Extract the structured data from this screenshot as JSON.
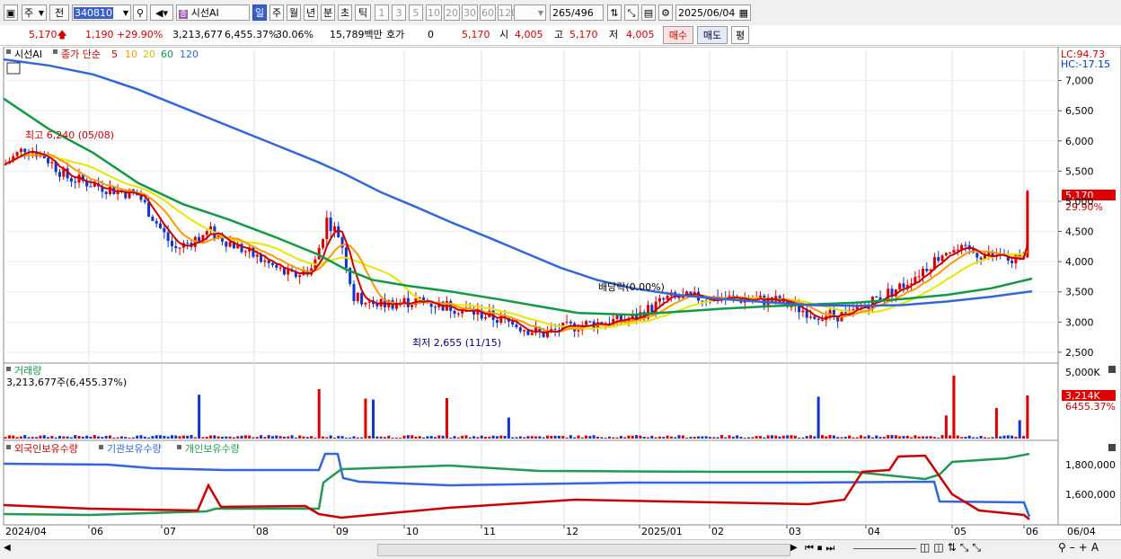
{
  "toolbar": {
    "market_select": "주",
    "type_select": "전",
    "code_value": "340810",
    "stock_name": "시선AI",
    "periods": [
      "일",
      "주",
      "월",
      "년",
      "분",
      "초",
      "틱"
    ],
    "period_selected": "일",
    "minutes": [
      "1",
      "3",
      "5",
      "10",
      "20",
      "30",
      "60",
      "120"
    ],
    "count_value": "265",
    "count_total": "/496",
    "date_value": "2025/06/04"
  },
  "quote": {
    "price": "5,170",
    "change": "1,190",
    "change_pct": "+29.90%",
    "volume": "3,213,677",
    "volume_pct": "6,455.37%",
    "turnover": "30.06%",
    "amount": "15,789백만",
    "hoga_label": "호가",
    "hoga_value": "0",
    "hoga_price": "5,170",
    "open_label": "시",
    "open_value": "4,005",
    "high_label": "고",
    "high_value": "5,170",
    "low_label": "저",
    "low_value": "4,005",
    "buy_label": "매수",
    "sell_label": "매도",
    "eval_label": "평"
  },
  "price_panel": {
    "stock_label": "시선AI",
    "ma_label": "종가 단순",
    "ma_periods": [
      "5",
      "10",
      "20",
      "60",
      "120"
    ],
    "ma_colors": [
      "#cc0000",
      "#ff9900",
      "#e6e600",
      "#119944",
      "#3366dd"
    ],
    "lc_label": "LC:94.73",
    "hc_label": "HC:-17.15",
    "high_annotation": "최고 6,240 (05/08)",
    "low_annotation": "최저 2,655 (11/15)",
    "dividend_annotation": "배당락(0.00%)",
    "current_price": "5,170",
    "current_pct": "29.90%",
    "y_ticks": [
      "7,000",
      "6,500",
      "6,000",
      "5,500",
      "5,000",
      "4,500",
      "4,000",
      "3,500",
      "3,000",
      "2,500"
    ]
  },
  "volume_panel": {
    "title": "거래량",
    "value_label": "3,213,677주(6,455.37%)",
    "y_tick": "5,000K",
    "current": "3,214K",
    "current_pct": "6455.37%"
  },
  "holding_panel": {
    "legend": [
      "외국인보유수량",
      "기관보유수량",
      "개인보유수량"
    ],
    "legend_colors": [
      "#cc0000",
      "#3366dd",
      "#229955"
    ],
    "y_ticks": [
      "1,800,000",
      "1,600,000"
    ]
  },
  "x_axis": [
    "2024/04",
    "06",
    "07",
    "08",
    "09",
    "10",
    "11",
    "12",
    "2025/01",
    "02",
    "03",
    "04",
    "05",
    "06",
    "06/04"
  ],
  "chart_data": {
    "type": "candlestick",
    "price_y_range": [
      2350,
      7500
    ],
    "moving_averages": {
      "ma60_points": [
        [
          0,
          6700
        ],
        [
          20,
          6500
        ],
        [
          50,
          6200
        ],
        [
          100,
          5800
        ],
        [
          150,
          5300
        ],
        [
          200,
          4950
        ],
        [
          250,
          4700
        ],
        [
          300,
          4420
        ],
        [
          350,
          4120
        ],
        [
          380,
          3880
        ],
        [
          410,
          3700
        ],
        [
          450,
          3600
        ],
        [
          500,
          3500
        ],
        [
          550,
          3380
        ],
        [
          600,
          3250
        ],
        [
          640,
          3150
        ],
        [
          700,
          3120
        ],
        [
          750,
          3170
        ],
        [
          800,
          3220
        ],
        [
          850,
          3260
        ],
        [
          900,
          3290
        ],
        [
          950,
          3320
        ],
        [
          1000,
          3380
        ],
        [
          1050,
          3450
        ],
        [
          1100,
          3560
        ],
        [
          1145,
          3720
        ]
      ],
      "ma120_points": [
        [
          0,
          7350
        ],
        [
          50,
          7250
        ],
        [
          100,
          7100
        ],
        [
          150,
          6850
        ],
        [
          200,
          6550
        ],
        [
          250,
          6250
        ],
        [
          300,
          5950
        ],
        [
          350,
          5650
        ],
        [
          380,
          5450
        ],
        [
          420,
          5150
        ],
        [
          460,
          4900
        ],
        [
          500,
          4640
        ],
        [
          540,
          4400
        ],
        [
          580,
          4150
        ],
        [
          620,
          3900
        ],
        [
          660,
          3700
        ],
        [
          700,
          3560
        ],
        [
          750,
          3450
        ],
        [
          800,
          3380
        ],
        [
          850,
          3330
        ],
        [
          900,
          3280
        ],
        [
          950,
          3270
        ],
        [
          1000,
          3280
        ],
        [
          1050,
          3340
        ],
        [
          1100,
          3420
        ],
        [
          1145,
          3510
        ]
      ]
    },
    "volume_y_max": "5,000K",
    "holding_y_ticks": [
      "1,800,000",
      "1,600,000"
    ]
  }
}
